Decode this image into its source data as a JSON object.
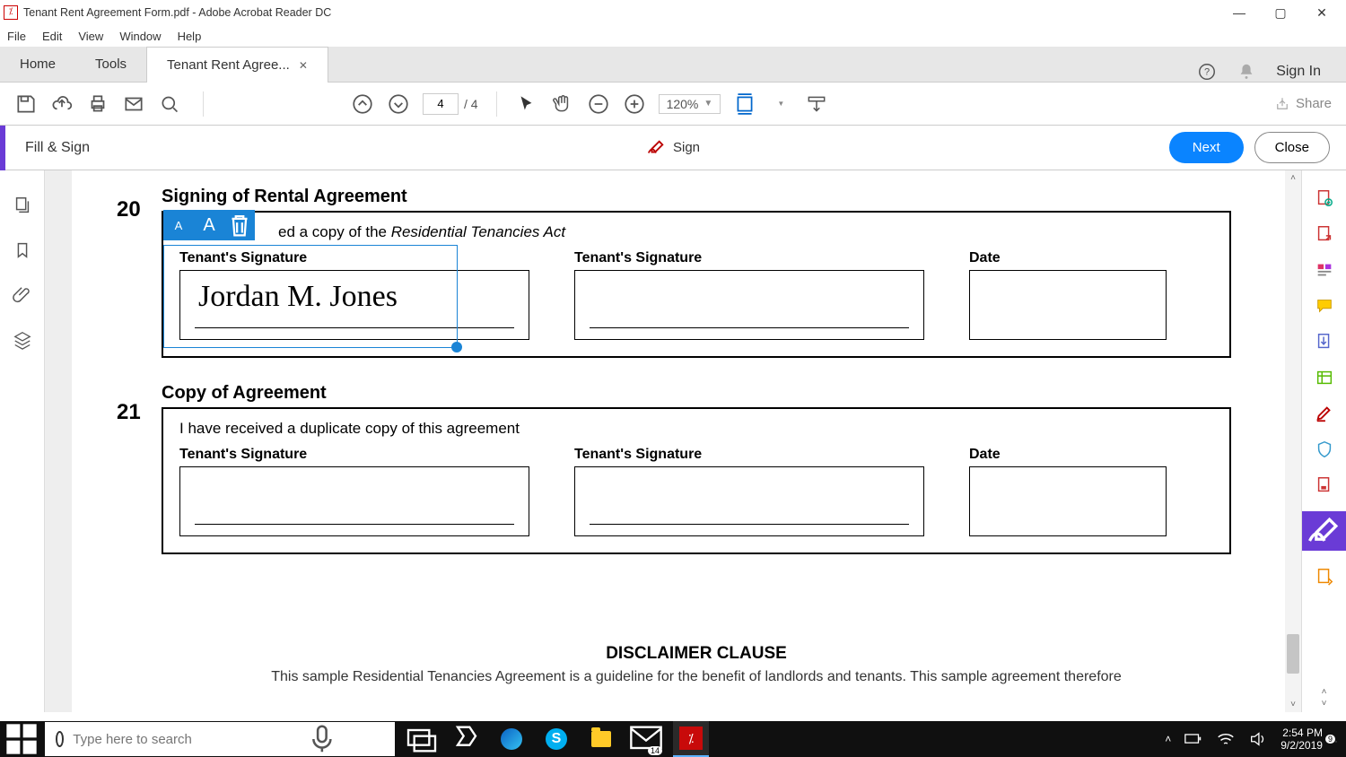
{
  "window": {
    "title": "Tenant Rent Agreement Form.pdf - Adobe Acrobat Reader DC"
  },
  "menu": {
    "file": "File",
    "edit": "Edit",
    "view": "View",
    "window": "Window",
    "help": "Help"
  },
  "tabs": {
    "home": "Home",
    "tools": "Tools",
    "doc": "Tenant Rent Agree..."
  },
  "header_right": {
    "sign_in": "Sign In"
  },
  "toolbar": {
    "page_current": "4",
    "page_total": "/ 4",
    "zoom": "120%",
    "share": "Share"
  },
  "fillsign": {
    "label": "Fill & Sign",
    "sign": "Sign",
    "next": "Next",
    "close": "Close"
  },
  "doc": {
    "sec20": {
      "num": "20",
      "heading": "Signing of Rental Agreement",
      "line_full": "I have received a copy of the Residential Tenancies Act",
      "line_visible_suffix": "ed a copy of the ",
      "line_italic": "Residential Tenancies Act",
      "sig1": "Tenant's Signature",
      "sig2": "Tenant's Signature",
      "date": "Date",
      "signature_text": "Jordan M. Jones"
    },
    "sec21": {
      "num": "21",
      "heading": "Copy of Agreement",
      "line": "I have received a duplicate copy of this agreement",
      "sig1": "Tenant's Signature",
      "sig2": "Tenant's Signature",
      "date": "Date"
    },
    "disclaimer": "DISCLAIMER CLAUSE",
    "disclaimer_body": "This sample Residential Tenancies Agreement  is a guideline for the benefit of landlords and tenants. This sample agreement  therefore"
  },
  "sig_toolbar": {
    "small": "A",
    "large": "A"
  },
  "search": {
    "placeholder": "Type here to search"
  },
  "tray": {
    "time": "2:54 PM",
    "date": "9/2/2019",
    "mail_badge": "14",
    "action_badge": "9"
  }
}
